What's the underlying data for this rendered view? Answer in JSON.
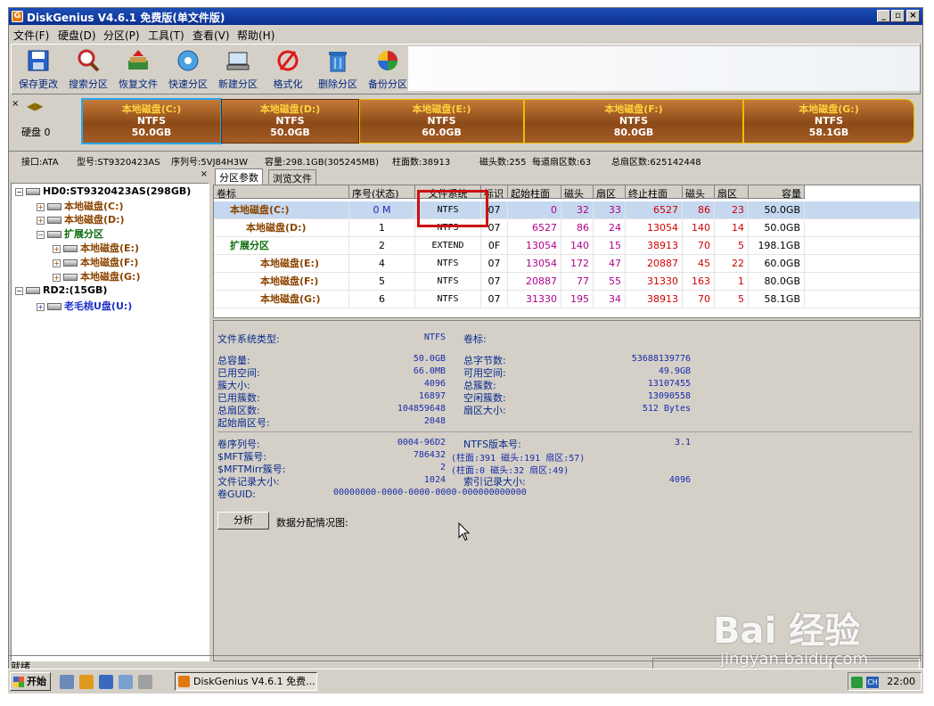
{
  "window": {
    "title": "DiskGenius V4.6.1 免费版(单文件版)"
  },
  "menu": [
    "文件(F)",
    "硬盘(D)",
    "分区(P)",
    "工具(T)",
    "查看(V)",
    "帮助(H)"
  ],
  "toolbar": [
    {
      "label": "保存更改",
      "icon": "save-icon"
    },
    {
      "label": "搜索分区",
      "icon": "magnifier-icon"
    },
    {
      "label": "恢复文件",
      "icon": "recover-icon"
    },
    {
      "label": "快速分区",
      "icon": "quick-partition-icon"
    },
    {
      "label": "新建分区",
      "icon": "new-partition-icon"
    },
    {
      "label": "格式化",
      "icon": "format-icon"
    },
    {
      "label": "删除分区",
      "icon": "trash-icon"
    },
    {
      "label": "备份分区",
      "icon": "backup-icon"
    }
  ],
  "banner": {
    "line1": "",
    "line2": "",
    "accent": "#e8343c"
  },
  "diskbar": {
    "disk_label": "硬盘 0",
    "partitions": [
      {
        "name": "本地磁盘(C:)",
        "fs": "NTFS",
        "size": "50.0GB"
      },
      {
        "name": "本地磁盘(D:)",
        "fs": "NTFS",
        "size": "50.0GB"
      },
      {
        "name": "本地磁盘(E:)",
        "fs": "NTFS",
        "size": "60.0GB"
      },
      {
        "name": "本地磁盘(F:)",
        "fs": "NTFS",
        "size": "80.0GB"
      },
      {
        "name": "本地磁盘(G:)",
        "fs": "NTFS",
        "size": "58.1GB"
      }
    ]
  },
  "disk_info": {
    "iface": "接口:ATA",
    "model": "型号:ST9320423AS",
    "serial": "序列号:5VJ84H3W",
    "capacity": "容量:298.1GB(305245MB)",
    "cylinders": "柱面数:38913",
    "heads": "磁头数:255",
    "sectors_track": "每道扇区数:63",
    "total_sectors": "总扇区数:625142448"
  },
  "tree": [
    {
      "text": "HD0:ST9320423AS(298GB)",
      "pm": "−",
      "cls": ""
    },
    {
      "text": "本地磁盘(C:)",
      "pm": "+",
      "cls": "brown"
    },
    {
      "text": "本地磁盘(D:)",
      "pm": "+",
      "cls": "brown"
    },
    {
      "text": "扩展分区",
      "pm": "−",
      "cls": "green"
    },
    {
      "text": "本地磁盘(E:)",
      "pm": "+",
      "cls": "brown"
    },
    {
      "text": "本地磁盘(F:)",
      "pm": "+",
      "cls": "brown"
    },
    {
      "text": "本地磁盘(G:)",
      "pm": "+",
      "cls": "brown"
    },
    {
      "text": "RD2:(15GB)",
      "pm": "−",
      "cls": ""
    },
    {
      "text": "老毛桃U盘(U:)",
      "pm": "+",
      "cls": "blue"
    }
  ],
  "tabs": [
    "分区参数",
    "浏览文件"
  ],
  "grid": {
    "headers": [
      "卷标",
      "序号(状态)",
      "文件系统",
      "标识",
      "起始柱面",
      "磁头",
      "扇区",
      "终止柱面",
      "磁头",
      "扇区",
      "容量"
    ],
    "rows": [
      {
        "label": "本地磁盘(C:)",
        "index": "0 M",
        "fs": "NTFS",
        "id": "07",
        "sc": "0",
        "sh": "32",
        "ss": "33",
        "ec": "6527",
        "eh": "86",
        "es": "23",
        "cap": "50.0GB"
      },
      {
        "label": "本地磁盘(D:)",
        "index": "1",
        "fs": "NTFS",
        "id": "07",
        "sc": "6527",
        "sh": "86",
        "ss": "24",
        "ec": "13054",
        "eh": "140",
        "es": "14",
        "cap": "50.0GB"
      },
      {
        "label": "扩展分区",
        "index": "2",
        "fs": "EXTEND",
        "id": "0F",
        "sc": "13054",
        "sh": "140",
        "ss": "15",
        "ec": "38913",
        "eh": "70",
        "es": "5",
        "cap": "198.1GB"
      },
      {
        "label": "本地磁盘(E:)",
        "index": "4",
        "fs": "NTFS",
        "id": "07",
        "sc": "13054",
        "sh": "172",
        "ss": "47",
        "ec": "20887",
        "eh": "45",
        "es": "22",
        "cap": "60.0GB"
      },
      {
        "label": "本地磁盘(F:)",
        "index": "5",
        "fs": "NTFS",
        "id": "07",
        "sc": "20887",
        "sh": "77",
        "ss": "55",
        "ec": "31330",
        "eh": "163",
        "es": "1",
        "cap": "80.0GB"
      },
      {
        "label": "本地磁盘(G:)",
        "index": "6",
        "fs": "NTFS",
        "id": "07",
        "sc": "31330",
        "sh": "195",
        "ss": "34",
        "ec": "38913",
        "eh": "70",
        "es": "5",
        "cap": "58.1GB"
      }
    ]
  },
  "details": {
    "fs_type_label": "文件系统类型:",
    "fs_type": "NTFS",
    "vol_label_label": "卷标:",
    "total_cap_label": "总容量:",
    "total_cap": "50.0GB",
    "total_bytes_label": "总字节数:",
    "total_bytes": "53688139776",
    "used_label": "已用空间:",
    "used": "66.0MB",
    "free_label": "可用空间:",
    "free": "49.9GB",
    "cluster_size_label": "簇大小:",
    "cluster_size": "4096",
    "total_clusters_label": "总簇数:",
    "total_clusters": "13107455",
    "used_clusters_label": "已用簇数:",
    "used_clusters": "16897",
    "free_clusters_label": "空闲簇数:",
    "free_clusters": "13090558",
    "total_sectors_label": "总扇区数:",
    "total_sectors": "104859648",
    "sector_size_label": "扇区大小:",
    "sector_size": "512 Bytes",
    "start_sector_label": "起始扇区号:",
    "start_sector": "2048",
    "serial_label": "卷序列号:",
    "serial": "0004-96D2",
    "ntfs_ver_label": "NTFS版本号:",
    "ntfs_ver": "3.1",
    "mft_label": "$MFT簇号:",
    "mft": "786432",
    "mft_chs": "(柱面:391 磁头:191 扇区:57)",
    "mftmirr_label": "$MFTMirr簇号:",
    "mftmirr": "2",
    "mftmirr_chs": "(柱面:0 磁头:32 扇区:49)",
    "frs_label": "文件记录大小:",
    "frs": "1024",
    "irs_label": "索引记录大小:",
    "irs": "4096",
    "guid_label": "卷GUID:",
    "guid": "00000000-0000-0000-0000-000000000000",
    "analyze": "分析",
    "alloc_label": "数据分配情况图:"
  },
  "status": {
    "text": "就绪"
  },
  "taskbar": {
    "start": "开始",
    "task": "DiskGenius V4.6.1 免费...",
    "ime": "CH",
    "clock": "22:00"
  },
  "watermark": {
    "brand": "Bai 经验",
    "url": "jingyan.baidu.com"
  }
}
